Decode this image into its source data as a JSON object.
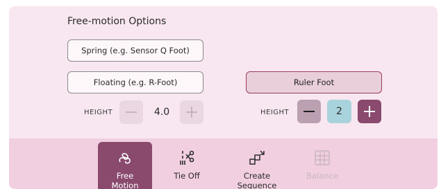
{
  "panel": {
    "title": "Free-motion Options"
  },
  "options": {
    "spring": "Spring (e.g. Sensor Q Foot)",
    "floating": "Floating (e.g. R-Foot)",
    "ruler": "Ruler Foot"
  },
  "height_left": {
    "label": "HEIGHT",
    "value": "4.0"
  },
  "height_right": {
    "label": "HEIGHT",
    "value": "2"
  },
  "toolbar": {
    "items": [
      {
        "label_line1": "Free",
        "label_line2": "Motion",
        "icon": "free-motion-icon",
        "active": true
      },
      {
        "label_line1": "Tie Off",
        "label_line2": "",
        "icon": "tie-off-icon",
        "active": false
      },
      {
        "label_line1": "Create",
        "label_line2": "Sequence",
        "icon": "create-sequence-icon",
        "active": false
      },
      {
        "label_line1": "Balance",
        "label_line2": "",
        "icon": "balance-icon",
        "active": false,
        "disabled": true
      }
    ]
  },
  "colors": {
    "panel_bg": "#f8e7f0",
    "toolbar_bg": "#f1cfe0",
    "active_tool": "#8a4a6e",
    "selected_option_border": "#9b3a5e",
    "value_box": "#a9d3dc"
  }
}
